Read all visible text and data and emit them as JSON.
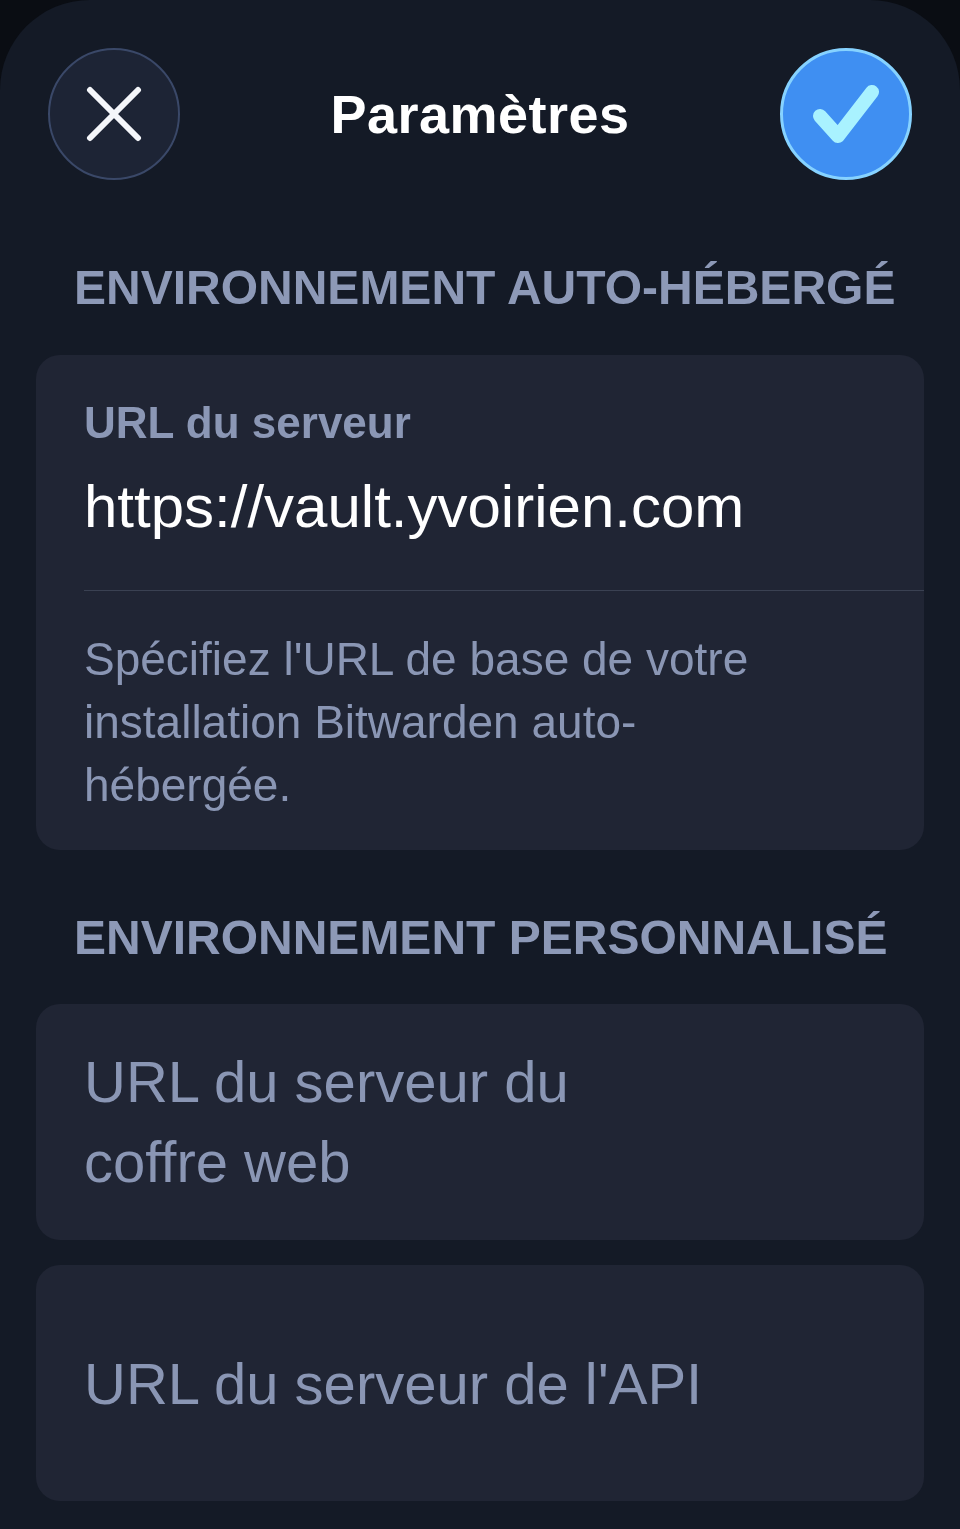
{
  "header": {
    "title": "Paramètres"
  },
  "sections": [
    {
      "title": "ENVIRONNEMENT AUTO-HÉBERGÉ",
      "fields": [
        {
          "kind": "labeled",
          "label": "URL du serveur",
          "value": "https://vault.yvoirien.com",
          "hint": "Spécifiez l'URL de base de votre installation Bitwarden auto-hébergée."
        }
      ]
    },
    {
      "title": "ENVIRONNEMENT PERSONNALISÉ",
      "fields": [
        {
          "kind": "multiline",
          "placeholder": "URL du serveur du coffre web"
        },
        {
          "kind": "single",
          "placeholder": "URL du serveur de l'API"
        }
      ]
    }
  ]
}
